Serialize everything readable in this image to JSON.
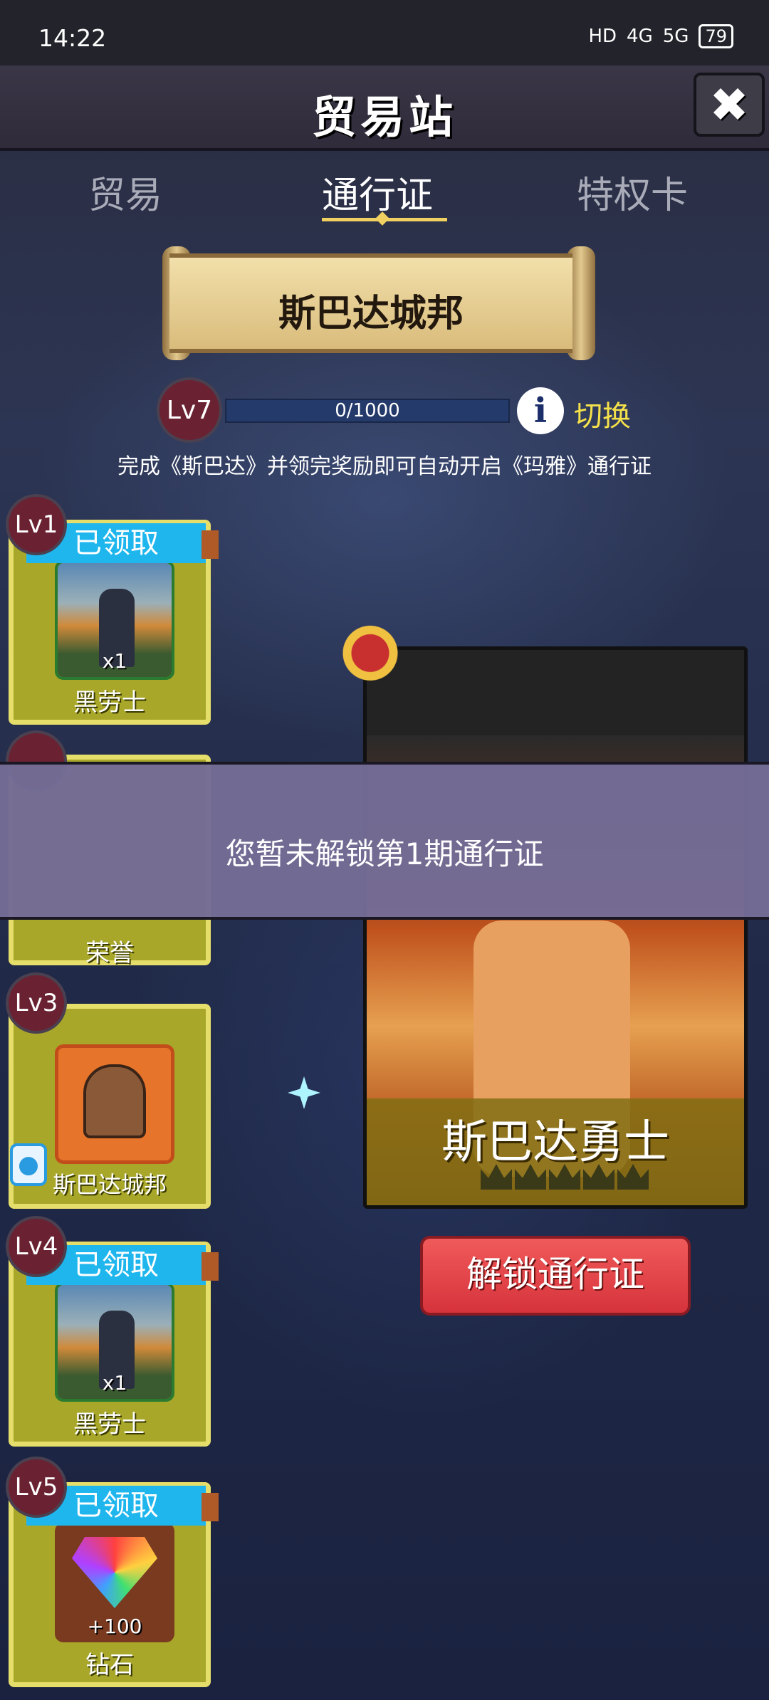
{
  "status_bar": {
    "time": "14:22",
    "indicators": [
      "HD",
      "4G",
      "5G"
    ],
    "battery": "79"
  },
  "header": {
    "title": "贸易站",
    "close_icon": "close-x-icon"
  },
  "tabs": [
    {
      "label": "贸易",
      "active": false
    },
    {
      "label": "通行证",
      "active": true
    },
    {
      "label": "特权卡",
      "active": false
    }
  ],
  "season": {
    "title": "斯巴达城邦",
    "level": "Lv7",
    "progress_text": "0/1000",
    "progress_fraction": 0,
    "switch_label": "切换",
    "notice": "完成《斯巴达》并领完奖励即可自动开启《玛雅》通行证"
  },
  "rewards": [
    {
      "level": "Lv1",
      "ribbon": "已领取",
      "name": "黑劳士",
      "qty": "x1",
      "icon": "knight-icon"
    },
    {
      "level": "",
      "ribbon": "",
      "name": "荣誉",
      "qty": "",
      "icon": ""
    },
    {
      "level": "Lv3",
      "ribbon": "",
      "name": "斯巴达城邦",
      "qty": "",
      "icon": "helmet-icon",
      "locked": true
    },
    {
      "level": "Lv4",
      "ribbon": "已领取",
      "name": "黑劳士",
      "qty": "x1",
      "icon": "knight-icon"
    },
    {
      "level": "Lv5",
      "ribbon": "已领取",
      "name": "钻石",
      "qty": "+100",
      "icon": "diamond-icon"
    }
  ],
  "preview": {
    "name": "斯巴达勇士",
    "star_count": 5,
    "unlock_button": "解锁通行证"
  },
  "toast": {
    "message": "您暂未解锁第1期通行证"
  },
  "colors": {
    "accent_gold": "#f0d060",
    "card_bg": "#a8a72a",
    "ribbon_blue": "#1fb6ee",
    "unlock_red": "#e0414a",
    "toast_bg": "#746c96"
  }
}
